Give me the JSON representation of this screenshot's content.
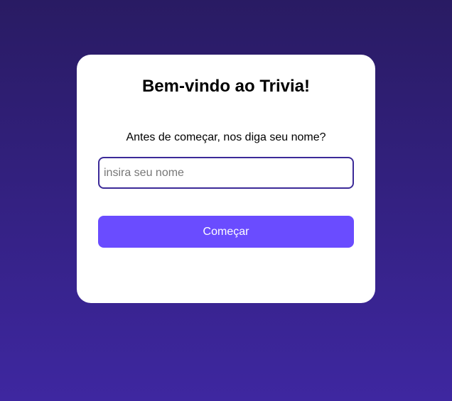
{
  "login": {
    "title": "Bem-vindo ao Trivia!",
    "prompt": "Antes de começar, nos diga seu nome?",
    "name_input": {
      "value": "",
      "placeholder": "insira seu nome"
    },
    "start_label": "Começar"
  },
  "colors": {
    "background_top": "#291b63",
    "background_bottom": "#3e27a0",
    "card": "#ffffff",
    "input_border": "#3c2a98",
    "button": "#6a4cff",
    "button_text": "#ffffff"
  }
}
